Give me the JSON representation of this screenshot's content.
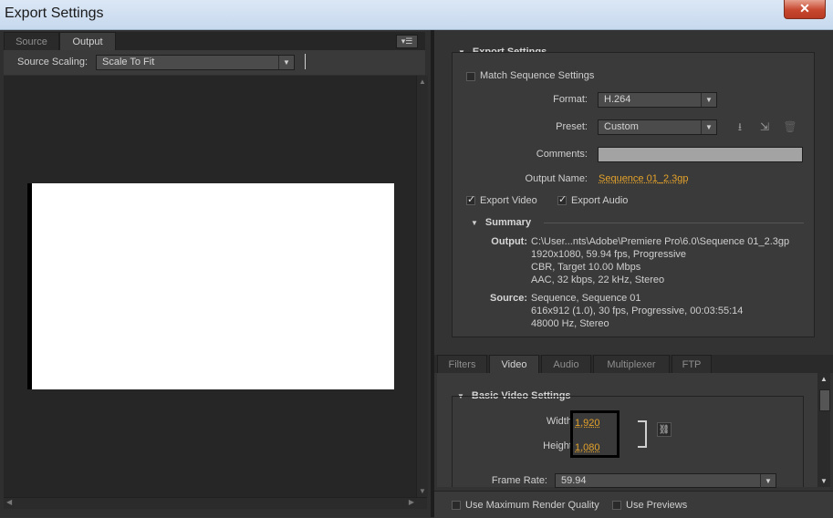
{
  "window": {
    "title": "Export Settings",
    "close_glyph": "✕"
  },
  "left_panel": {
    "tabs": [
      {
        "label": "Source"
      },
      {
        "label": "Output"
      }
    ],
    "panel_menu_glyph": "▾☰",
    "source_scaling": {
      "label": "Source Scaling:",
      "value": "Scale To Fit"
    }
  },
  "export_settings": {
    "header": "Export Settings",
    "match_sequence": {
      "label": "Match Sequence Settings",
      "checked": false
    },
    "format": {
      "label": "Format:",
      "value": "H.264"
    },
    "preset": {
      "label": "Preset:",
      "value": "Custom"
    },
    "comments": {
      "label": "Comments:",
      "value": ""
    },
    "output_name": {
      "label": "Output Name:",
      "value": "Sequence 01_2.3gp"
    },
    "export_video": {
      "label": "Export Video",
      "checked": true
    },
    "export_audio": {
      "label": "Export Audio",
      "checked": true
    }
  },
  "summary": {
    "header": "Summary",
    "output_label": "Output:",
    "output_lines": [
      "C:\\User...nts\\Adobe\\Premiere Pro\\6.0\\Sequence 01_2.3gp",
      "1920x1080, 59.94 fps, Progressive",
      "CBR, Target 10.00 Mbps",
      "AAC, 32 kbps, 22 kHz, Stereo"
    ],
    "source_label": "Source:",
    "source_lines": [
      "Sequence, Sequence 01",
      "616x912 (1.0), 30 fps, Progressive, 00:03:55:14",
      "48000 Hz, Stereo"
    ]
  },
  "bottom_tabs": [
    {
      "label": "Filters"
    },
    {
      "label": "Video"
    },
    {
      "label": "Audio"
    },
    {
      "label": "Multiplexer"
    },
    {
      "label": "FTP"
    }
  ],
  "video": {
    "header": "Basic Video Settings",
    "width": {
      "label": "Width:",
      "value": "1,920"
    },
    "height": {
      "label": "Height:",
      "value": "1,080"
    },
    "frame_rate": {
      "label": "Frame Rate:",
      "value": "59.94"
    }
  },
  "footer": {
    "max_render": {
      "label": "Use Maximum Render Quality",
      "checked": false
    },
    "use_previews": {
      "label": "Use Previews",
      "checked": false
    }
  },
  "colors": {
    "accent_link": "#e4a22a",
    "panel_bg": "#333333"
  }
}
